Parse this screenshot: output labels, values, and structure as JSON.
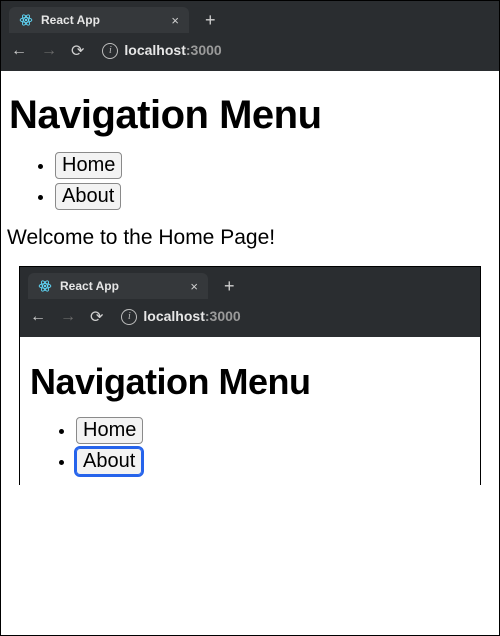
{
  "frame1": {
    "tab": {
      "title": "React App",
      "icon": "react-icon"
    },
    "url": {
      "host": "localhost",
      "port": ":3000"
    },
    "page": {
      "heading": "Navigation Menu",
      "nav_items": {
        "home": "Home",
        "about": "About"
      },
      "body_text": "Welcome to the Home Page!"
    }
  },
  "frame2": {
    "tab": {
      "title": "React App",
      "icon": "react-icon"
    },
    "url": {
      "host": "localhost",
      "port": ":3000"
    },
    "page": {
      "heading": "Navigation Menu",
      "nav_items": {
        "home": "Home",
        "about": "About"
      }
    }
  }
}
